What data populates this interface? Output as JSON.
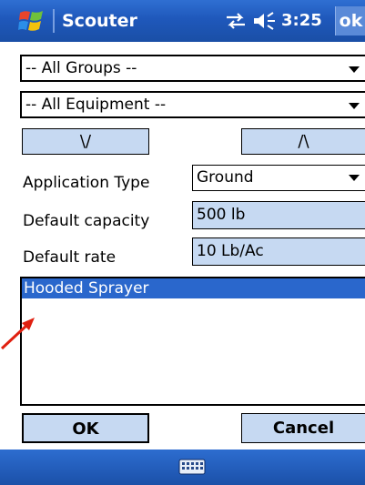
{
  "titlebar": {
    "app_title": "Scouter",
    "time": "3:25",
    "ok_label": "ok",
    "icons": [
      "windows-start-icon",
      "network-sync-icon",
      "volume-icon"
    ]
  },
  "filters": {
    "groups_value": "-- All Groups --",
    "equipment_value": "-- All Equipment --"
  },
  "move": {
    "down_label": "\\/",
    "up_label": "/\\"
  },
  "form": {
    "application_type_label": "Application Type",
    "application_type_value": "Ground",
    "default_capacity_label": "Default capacity",
    "default_capacity_value": "500 lb",
    "default_rate_label": "Default rate",
    "default_rate_value": "10 Lb/Ac"
  },
  "list": {
    "items": [
      "Hooded Sprayer"
    ],
    "selected_index": 0
  },
  "buttons": {
    "ok_label": "OK",
    "cancel_label": "Cancel"
  },
  "taskbar": {
    "icon": "keyboard-icon"
  },
  "colors": {
    "titlebar": "#1f58bb",
    "selection": "#2a67cc",
    "button_fill": "#c6d9f2",
    "annotation_arrow": "#e02010"
  }
}
